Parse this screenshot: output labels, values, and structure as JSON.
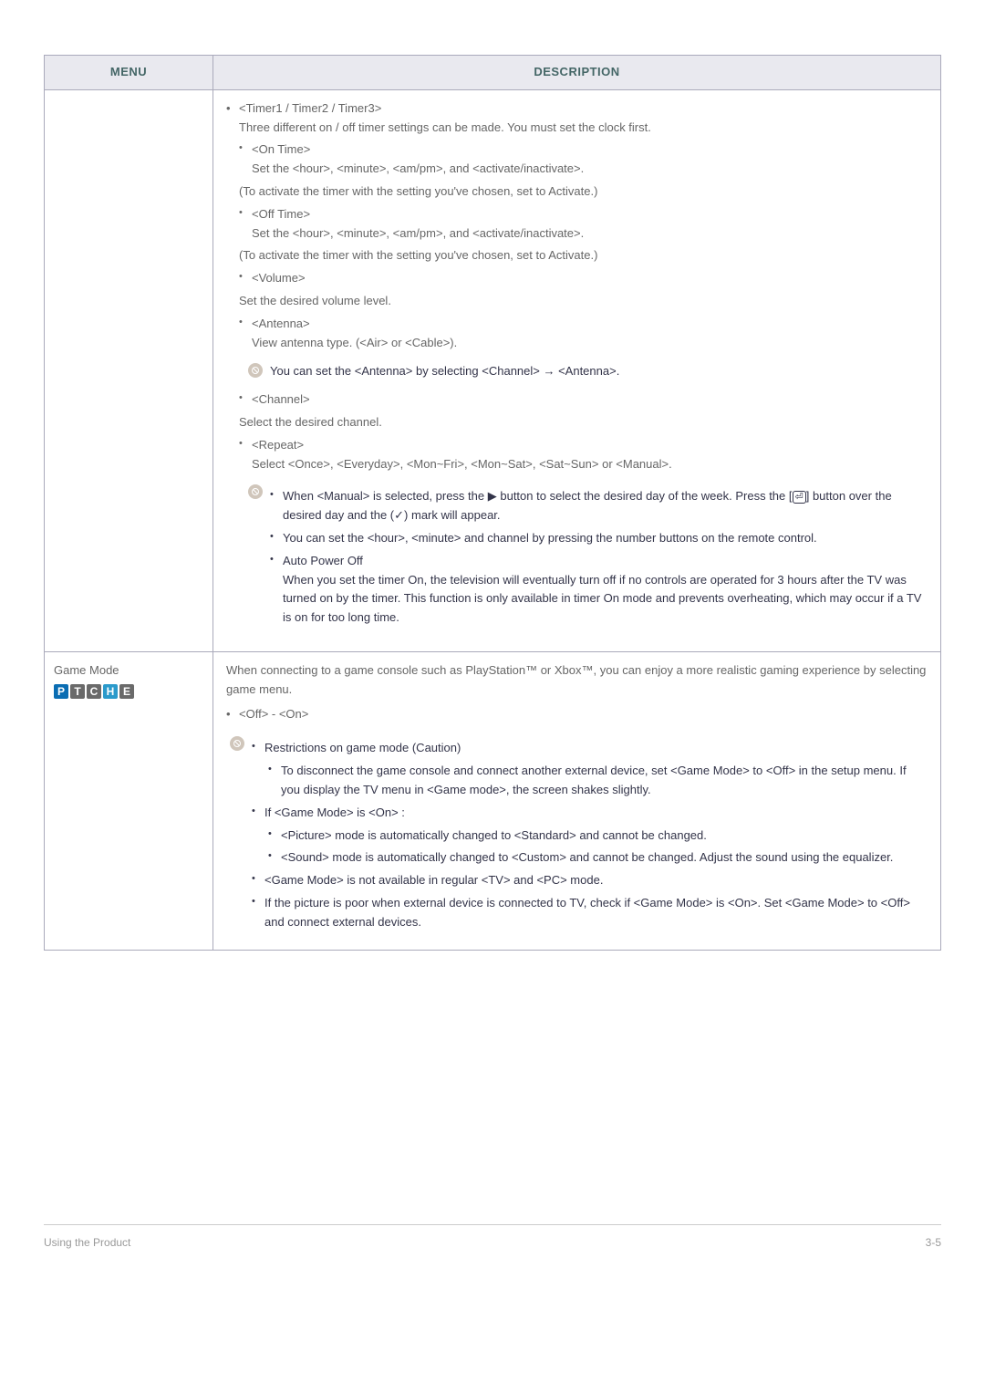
{
  "header": {
    "menu": "MENU",
    "description": "DESCRIPTION"
  },
  "row1": {
    "d": {
      "timer_title": "<Timer1 / Timer2 / Timer3>",
      "timer_intro": "Three different on / off timer settings can be made. You must set the clock first.",
      "on_time": "<On Time>",
      "on_time_set": "Set the <hour>, <minute>, <am/pm>, and <activate/inactivate>.",
      "on_time_act": "(To activate the timer with the setting you've chosen, set to Activate.)",
      "off_time": "<Off Time>",
      "off_time_set": "Set the <hour>, <minute>, <am/pm>, and <activate/inactivate>.",
      "off_time_act": "(To activate the timer with the setting you've chosen, set to Activate.)",
      "volume": "<Volume>",
      "volume_set": "Set the desired volume level.",
      "antenna": "<Antenna>",
      "antenna_view": "View antenna type. (<Air> or <Cable>).",
      "note_antenna": "You can set the <Antenna> by selecting <Channel> → <Antenna>.",
      "channel": "<Channel>",
      "channel_sel": "Select the desired channel.",
      "repeat": "<Repeat>",
      "repeat_sel": "Select <Once>, <Everyday>, <Mon~Fri>, <Mon~Sat>, <Sat~Sun> or <Manual>.",
      "man_a": "When <Manual> is selected, press the ",
      "man_b": " button to select the desired day of the week. Press the [",
      "man_c": "] button over the desired day and the (",
      "man_d": ") mark will appear.",
      "man_set": "You can set the <hour>, <minute> and channel by pressing the number buttons on the remote control.",
      "auto_off": "Auto Power Off",
      "auto_off_desc": "When you set the timer On, the television will eventually turn off if no controls are operated for 3 hours after the TV was turned on by the timer. This function is only available in timer On mode and prevents overheating, which may occur if a TV is on for too long time."
    }
  },
  "row2": {
    "menu": "Game Mode",
    "badges": [
      "P",
      "T",
      "C",
      "H",
      "E"
    ],
    "d": {
      "intro": "When connecting to a game console such as PlayStation™ or Xbox™, you can enjoy a more realistic gaming experience by selecting game menu.",
      "offon": "<Off> - <On>",
      "restr": "Restrictions on game mode (Caution)",
      "r1": "To disconnect the game console and connect another external device, set <Game Mode> to <Off> in the setup menu. If you display the TV menu in <Game mode>, the screen shakes slightly.",
      "if_on": "If <Game Mode> is <On> :",
      "p1": "<Picture> mode is automatically changed to <Standard> and cannot be changed.",
      "p2": "<Sound> mode is automatically changed to <Custom> and cannot be changed. Adjust the sound using the equalizer.",
      "na": "<Game Mode> is not available in regular <TV> and <PC> mode.",
      "poor": "If the picture is poor when external device is connected to TV, check if <Game Mode> is <On>. Set <Game Mode> to <Off> and connect external devices."
    }
  },
  "footer": {
    "left": "Using the Product",
    "right": "3-5"
  },
  "glyph": {
    "triangle": "▶",
    "check": "✓",
    "enter": "⏎"
  }
}
